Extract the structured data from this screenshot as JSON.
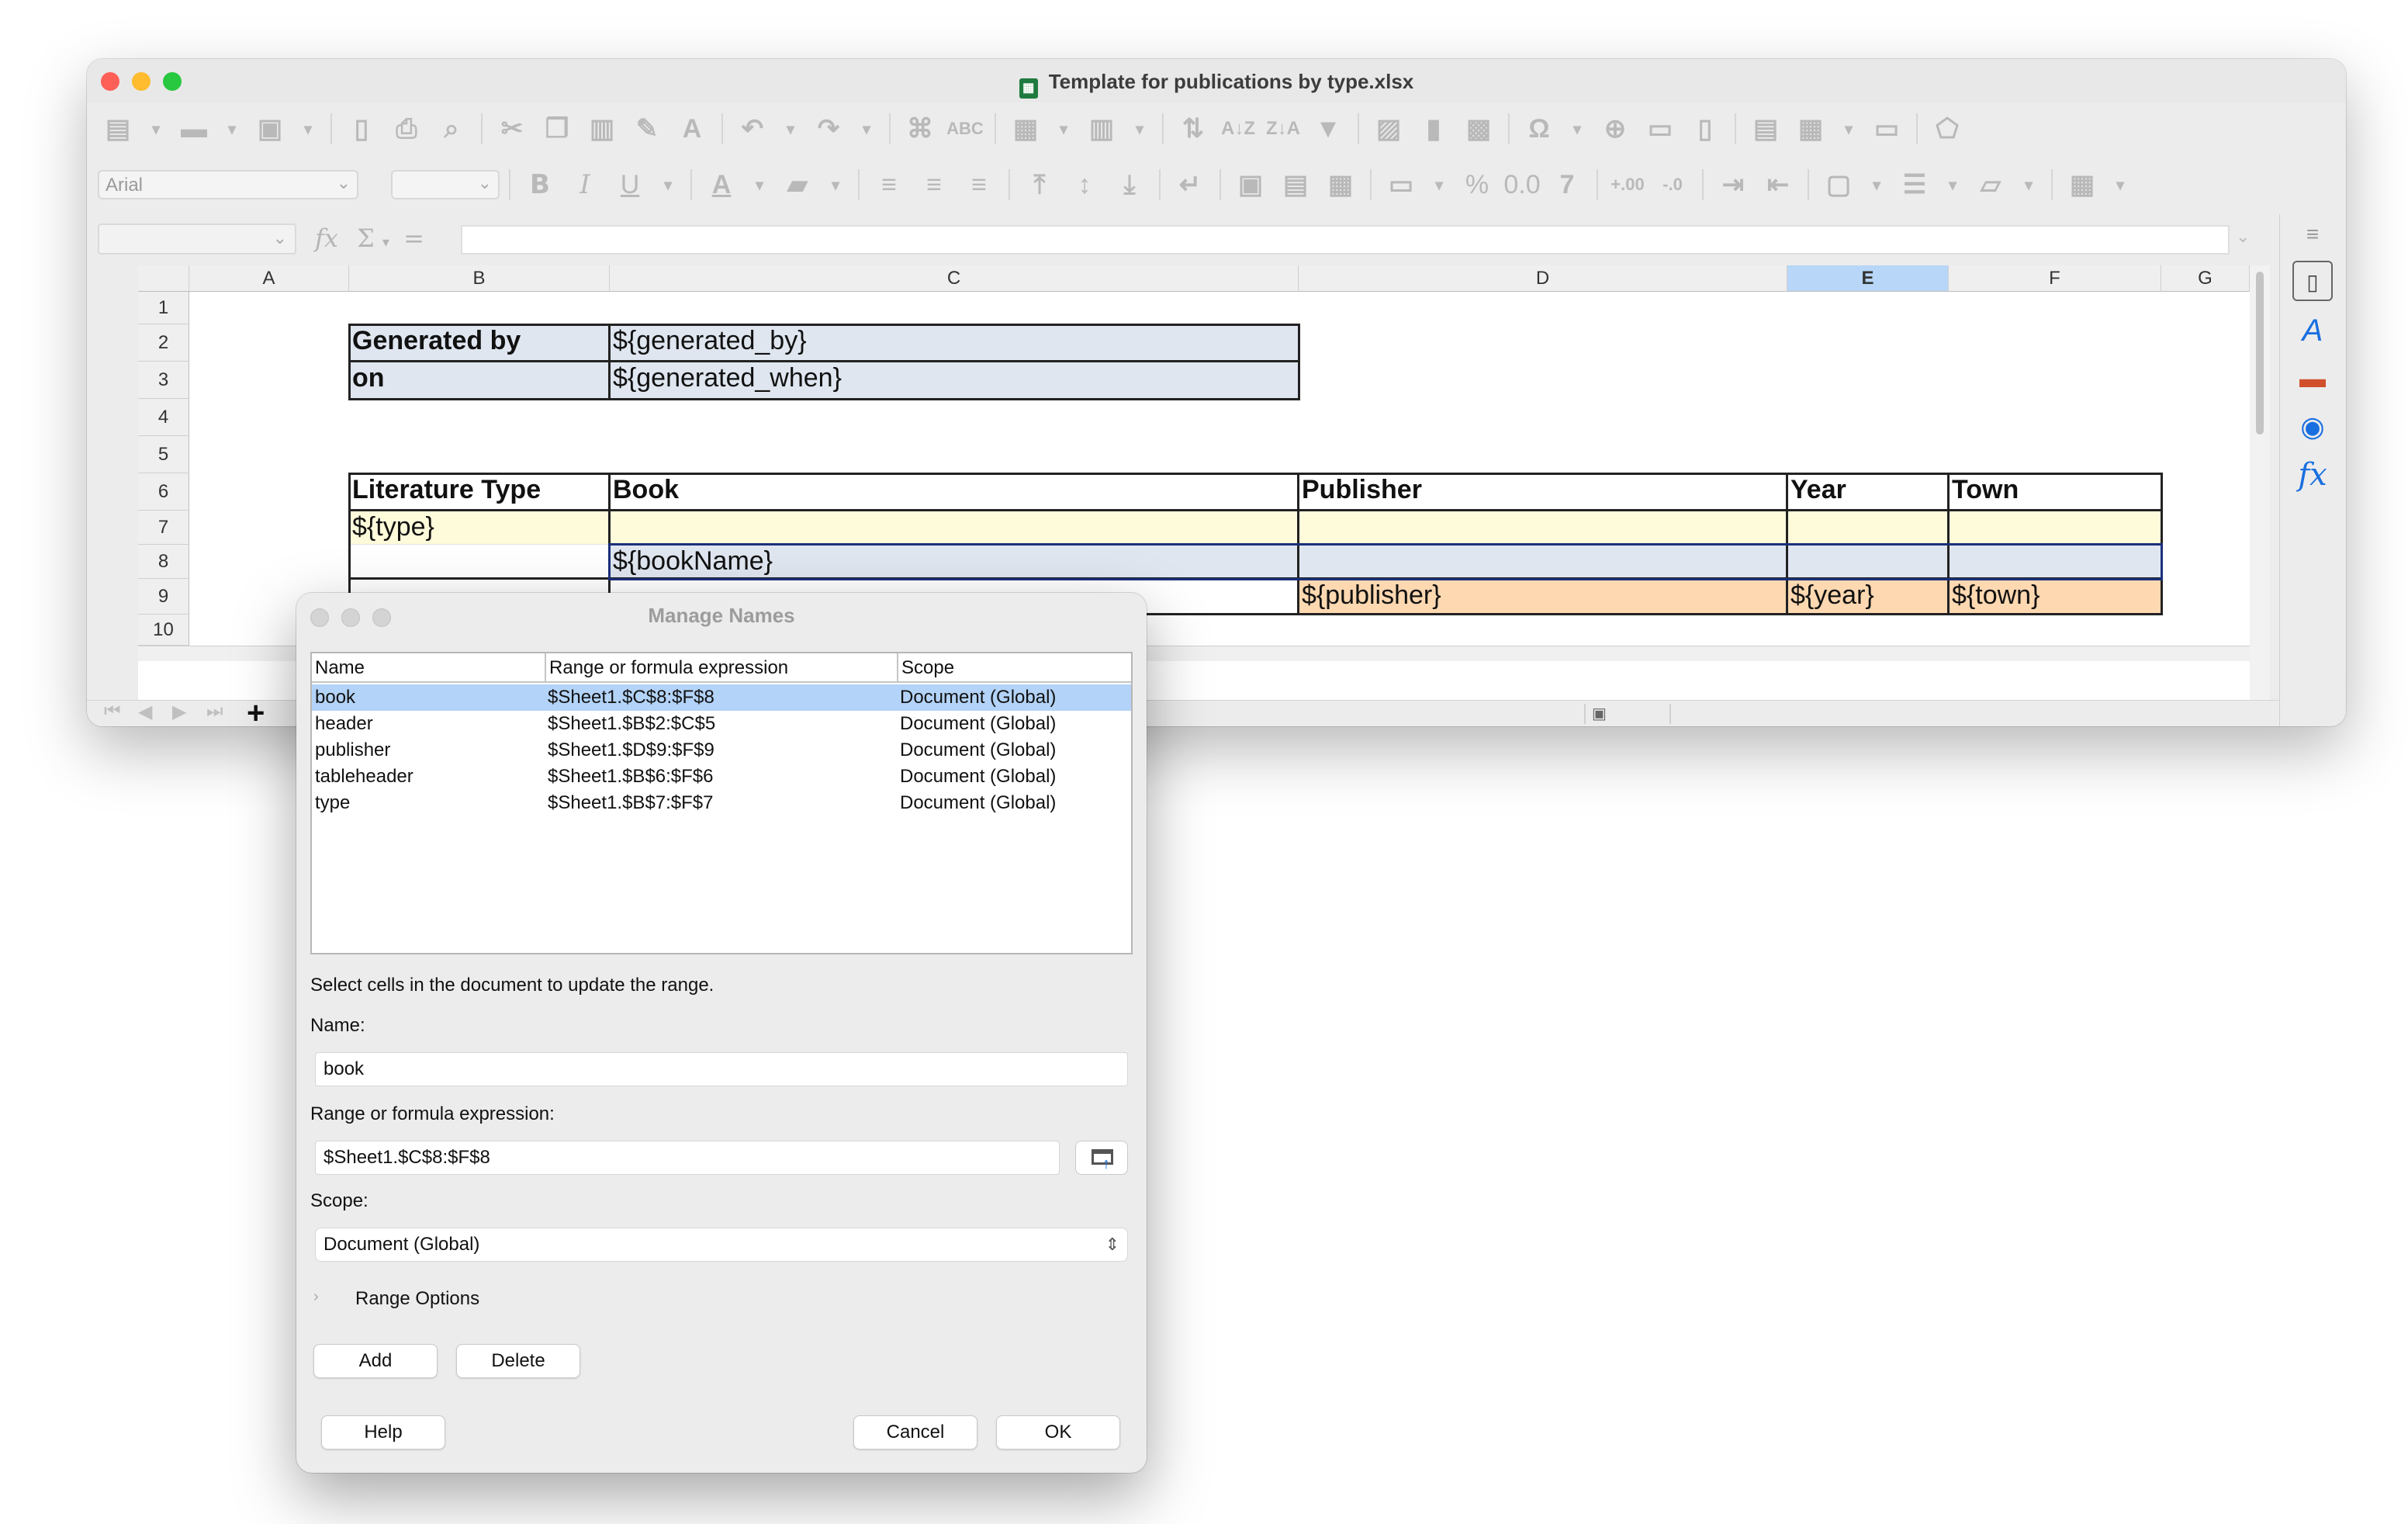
{
  "window": {
    "title": "Template for publications by type.xlsx",
    "file_icon": "spreadsheet-icon"
  },
  "toolbar": {
    "font_name": "Arial",
    "font_size": ""
  },
  "formula_bar": {
    "cell_ref": "",
    "content": ""
  },
  "sheet": {
    "columns": [
      "A",
      "B",
      "C",
      "D",
      "E",
      "F",
      "G"
    ],
    "selected_column": "E",
    "rows": [
      "1",
      "2",
      "3",
      "4",
      "5",
      "6",
      "7",
      "8",
      "9",
      "10"
    ],
    "cells": {
      "B2": "Generated by",
      "C2": "${generated_by}",
      "B3": "on",
      "C3": "${generated_when}",
      "B6": "Literature Type",
      "C6": "Book",
      "D6": "Publisher",
      "E6": "Year",
      "F6": "Town",
      "B7": "${type}",
      "C8": "${bookName}",
      "D9": "${publisher}",
      "E9": "${year}",
      "F9": "${town}"
    },
    "colors": {
      "header_fill": "#dfe6f0",
      "type_fill": "#fefbdb",
      "book_fill": "#dfe6f0",
      "publisher_fill": "#fdd8b0"
    }
  },
  "dialog": {
    "title": "Manage Names",
    "table": {
      "headers": [
        "Name",
        "Range or formula expression",
        "Scope"
      ],
      "rows": [
        {
          "name": "book",
          "range": "$Sheet1.$C$8:$F$8",
          "scope": "Document (Global)"
        },
        {
          "name": "header",
          "range": "$Sheet1.$B$2:$C$5",
          "scope": "Document (Global)"
        },
        {
          "name": "publisher",
          "range": "$Sheet1.$D$9:$F$9",
          "scope": "Document (Global)"
        },
        {
          "name": "tableheader",
          "range": "$Sheet1.$B$6:$F$6",
          "scope": "Document (Global)"
        },
        {
          "name": "type",
          "range": "$Sheet1.$B$7:$F$7",
          "scope": "Document (Global)"
        }
      ]
    },
    "hint": "Select cells in the document to update the range.",
    "name_label": "Name:",
    "name_value": "book",
    "range_label": "Range or formula expression:",
    "range_value": "$Sheet1.$C$8:$F$8",
    "scope_label": "Scope:",
    "scope_value": "Document (Global)",
    "range_options": "Range Options",
    "buttons": {
      "add": "Add",
      "delete": "Delete",
      "help": "Help",
      "cancel": "Cancel",
      "ok": "OK"
    }
  }
}
